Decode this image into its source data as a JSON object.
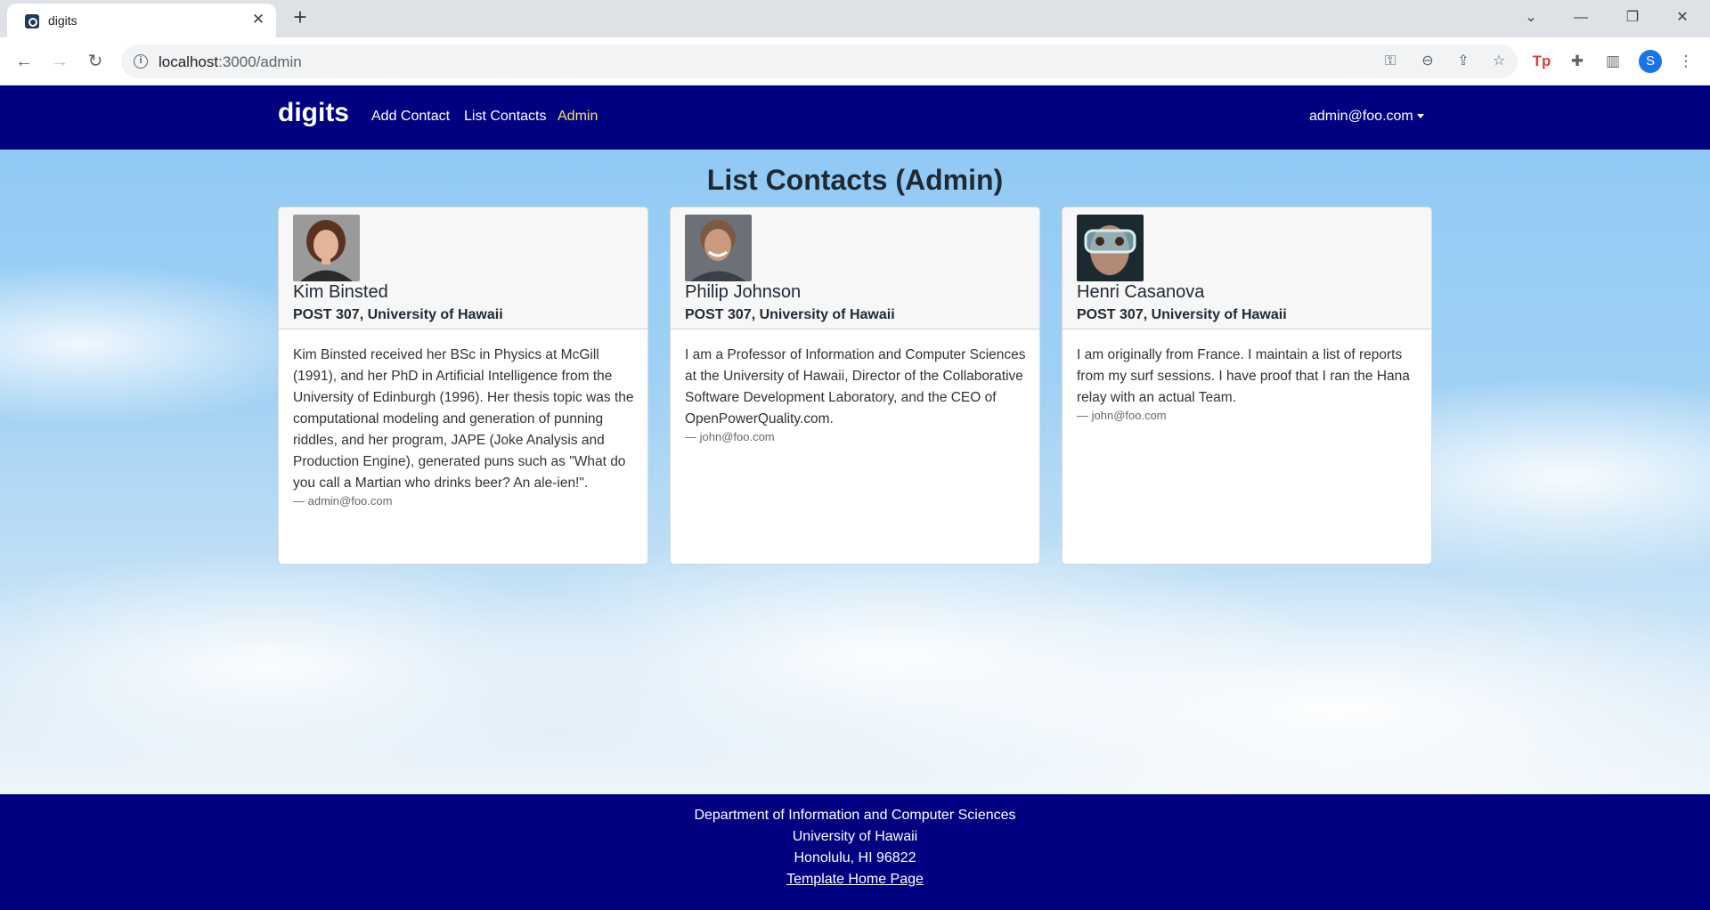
{
  "browser": {
    "tab_title": "digits",
    "url_host": "localhost",
    "url_path": ":3000/admin",
    "profile_initial": "S"
  },
  "navbar": {
    "brand": "digits",
    "links": [
      "Add Contact",
      "List Contacts",
      "Admin"
    ],
    "active_link": "Admin",
    "user": "admin@foo.com"
  },
  "page": {
    "title": "List Contacts (Admin)"
  },
  "contacts": [
    {
      "name": "Kim Binsted",
      "address": "POST 307, University of Hawaii",
      "description": "Kim Binsted received her BSc in Physics at McGill (1991), and her PhD in Artificial Intelligence from the University of Edinburgh (1996). Her thesis topic was the computational modeling and generation of punning riddles, and her program, JAPE (Joke Analysis and Production Engine), generated puns such as \"What do you call a Martian who drinks beer? An ale-ien!\".",
      "owner": "— admin@foo.com"
    },
    {
      "name": "Philip Johnson",
      "address": "POST 307, University of Hawaii",
      "description": "I am a Professor of Information and Computer Sciences at the University of Hawaii, Director of the Collaborative Software Development Laboratory, and the CEO of OpenPowerQuality.com.",
      "owner": "— john@foo.com"
    },
    {
      "name": "Henri Casanova",
      "address": "POST 307, University of Hawaii",
      "description": "I am originally from France. I maintain a list of reports from my surf sessions. I have proof that I ran the Hana relay with an actual Team.",
      "owner": "— john@foo.com"
    }
  ],
  "footer": {
    "line1": "Department of Information and Computer Sciences",
    "line2": "University of Hawaii",
    "line3": "Honolulu, HI 96822",
    "link": "Template Home Page"
  },
  "colors": {
    "navbar_bg": "#000080",
    "active_link": "#f5e46b",
    "footer_bg": "#000080"
  }
}
